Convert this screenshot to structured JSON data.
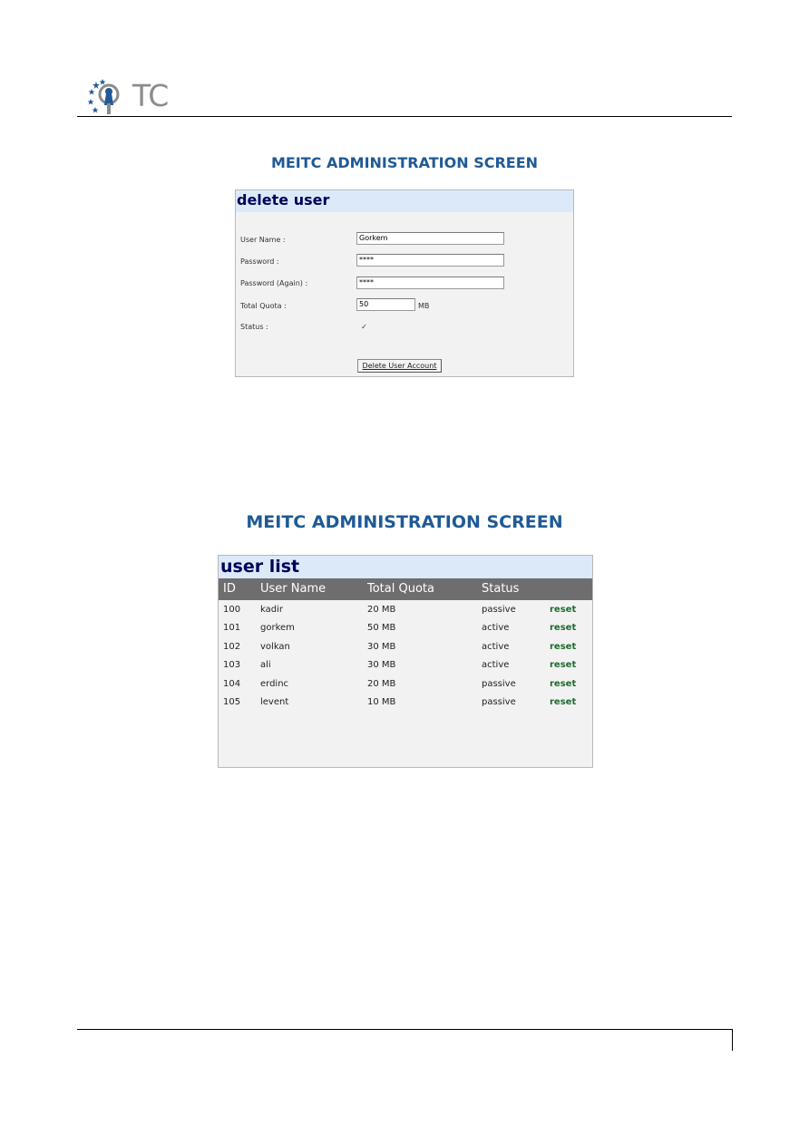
{
  "logo": {
    "text": "TC"
  },
  "delete_screen": {
    "title": "MEITC ADMINISTRATION SCREEN",
    "panel_title": "delete user",
    "fields": {
      "username_label": "User Name :",
      "username_value": "Gorkem",
      "password_label": "Password :",
      "password_value": "****",
      "password_again_label": "Password (Again) :",
      "password_again_value": "****",
      "quota_label": "Total Quota :",
      "quota_value": "50",
      "quota_unit": "MB",
      "status_label": "Status :",
      "status_checked": "✓"
    },
    "button_label": "Delete User Account"
  },
  "list_screen": {
    "title": "MEITC ADMINISTRATION SCREEN",
    "panel_title": "user list",
    "columns": [
      "ID",
      "User Name",
      "Total Quota",
      "Status"
    ],
    "rows": [
      {
        "id": "100",
        "name": "kadir",
        "quota": "20 MB",
        "status": "passive",
        "action": "reset"
      },
      {
        "id": "101",
        "name": "gorkem",
        "quota": "50 MB",
        "status": "active",
        "action": "reset"
      },
      {
        "id": "102",
        "name": "volkan",
        "quota": "30 MB",
        "status": "active",
        "action": "reset"
      },
      {
        "id": "103",
        "name": "ali",
        "quota": "30 MB",
        "status": "active",
        "action": "reset"
      },
      {
        "id": "104",
        "name": "erdinc",
        "quota": "20 MB",
        "status": "passive",
        "action": "reset"
      },
      {
        "id": "105",
        "name": "levent",
        "quota": "10 MB",
        "status": "passive",
        "action": "reset"
      }
    ]
  },
  "colors": {
    "title": "#1f5a96",
    "panel_head": "#dce9f8",
    "table_head": "#6e6e6e",
    "reset_link": "#1f6b2d"
  }
}
